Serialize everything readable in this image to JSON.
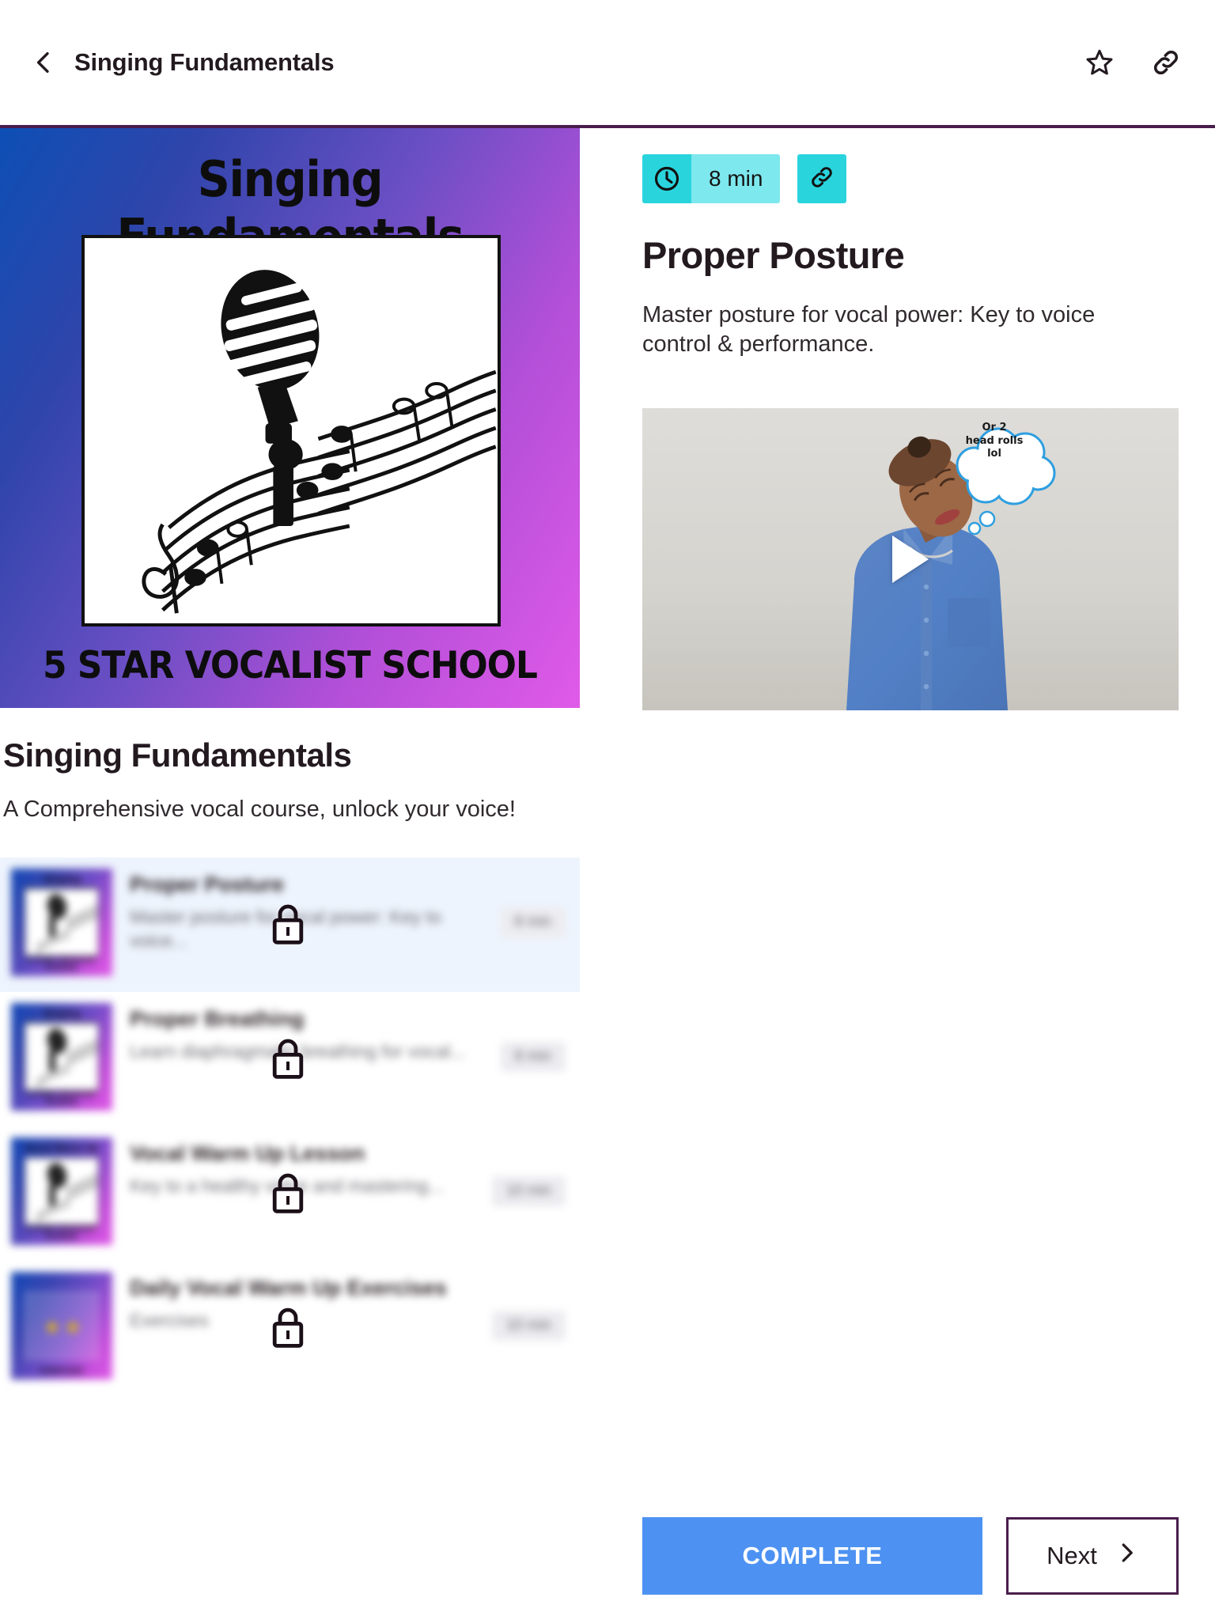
{
  "header": {
    "title": "Singing Fundamentals",
    "back_icon": "chevron-left-icon",
    "favorite_icon": "star-outline-icon",
    "share_icon": "link-icon"
  },
  "course": {
    "cover": {
      "title": "Singing Fundamentals",
      "subtitle": "5 STAR VOCALIST SCHOOL",
      "art": "vintage-microphone-with-music-staff"
    },
    "title": "Singing Fundamentals",
    "description": "A Comprehensive vocal course, unlock your voice!"
  },
  "lessons": [
    {
      "name": "Proper Posture",
      "subtitle": "Master posture for vocal power: Key to voice...",
      "duration": "8 min",
      "locked": true,
      "selected": true,
      "thumb_title": "Singing Fundamentals",
      "thumb_sub": "5 STAR VOCALIST SCHOOL"
    },
    {
      "name": "Proper Breathing",
      "subtitle": "Learn diaphragmatic breathing for vocal...",
      "duration": "8 min",
      "locked": true,
      "selected": false,
      "thumb_title": "Singing Fundamentals",
      "thumb_sub": "5 STAR VOCALIST SCHOOL"
    },
    {
      "name": "Vocal Warm Up Lesson",
      "subtitle": "Key to a healthy voice and mastering...",
      "duration": "10 min",
      "locked": true,
      "selected": false,
      "thumb_title": "Vocal Warm Up",
      "thumb_sub": "5 STAR VOCALIST SCHOOL"
    },
    {
      "name": "Daily Vocal Warm Up Exercises",
      "subtitle": "Exercises",
      "duration": "10 min",
      "locked": true,
      "selected": false,
      "thumb_title": "",
      "thumb_sub": "EXERCISES"
    }
  ],
  "lesson_detail": {
    "duration_badge": "8 min",
    "clock_icon": "clock-icon",
    "share_icon": "link-icon",
    "title": "Proper Posture",
    "description": "Master posture for vocal power: Key to voice\ncontrol & performance.",
    "video": {
      "play_icon": "play-triangle-icon",
      "bubble_text": "Or 2\nhead rolls\nlol",
      "alt": "woman-in-blue-denim-shirt-tilting-head"
    }
  },
  "footer": {
    "complete_label": "COMPLETE",
    "next_label": "Next",
    "next_icon": "chevron-right-icon"
  },
  "colors": {
    "accent_purple": "#4a1d4c",
    "badge_cyan_dark": "#2ad4dd",
    "badge_cyan_light": "#7de8ed",
    "complete_blue": "#4d92f2",
    "selected_row": "#eef4fd"
  }
}
